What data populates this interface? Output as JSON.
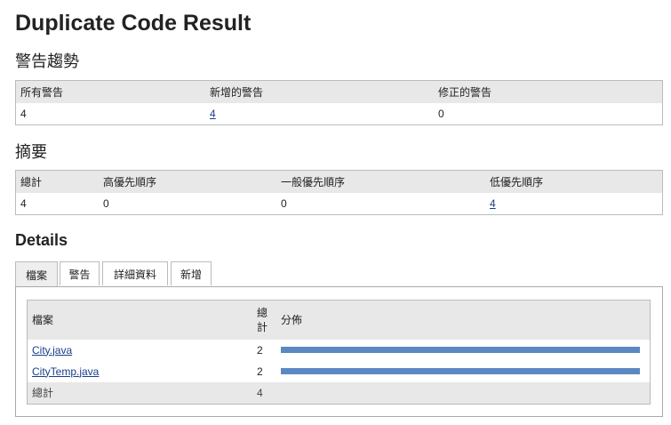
{
  "title": "Duplicate Code Result",
  "trend": {
    "heading": "警告趨勢",
    "headers": [
      "所有警告",
      "新增的警告",
      "修正的警告"
    ],
    "values": [
      "4",
      "4",
      "0"
    ]
  },
  "summary": {
    "heading": "摘要",
    "headers": [
      "總計",
      "高優先順序",
      "一般優先順序",
      "低優先順序"
    ],
    "values": [
      "4",
      "0",
      "0",
      "4"
    ]
  },
  "details": {
    "heading": "Details",
    "tabs": [
      "檔案",
      "警告",
      "詳細資料",
      "新增"
    ],
    "active_tab": "檔案",
    "table": {
      "headers": [
        "檔案",
        "總計",
        "分佈"
      ],
      "rows": [
        {
          "file": "City.java",
          "total": "2",
          "fraction": 1.0
        },
        {
          "file": "CityTemp.java",
          "total": "2",
          "fraction": 1.0
        }
      ],
      "footer": {
        "label": "總計",
        "total": "4"
      }
    },
    "bar_color": "#5b88c2"
  }
}
